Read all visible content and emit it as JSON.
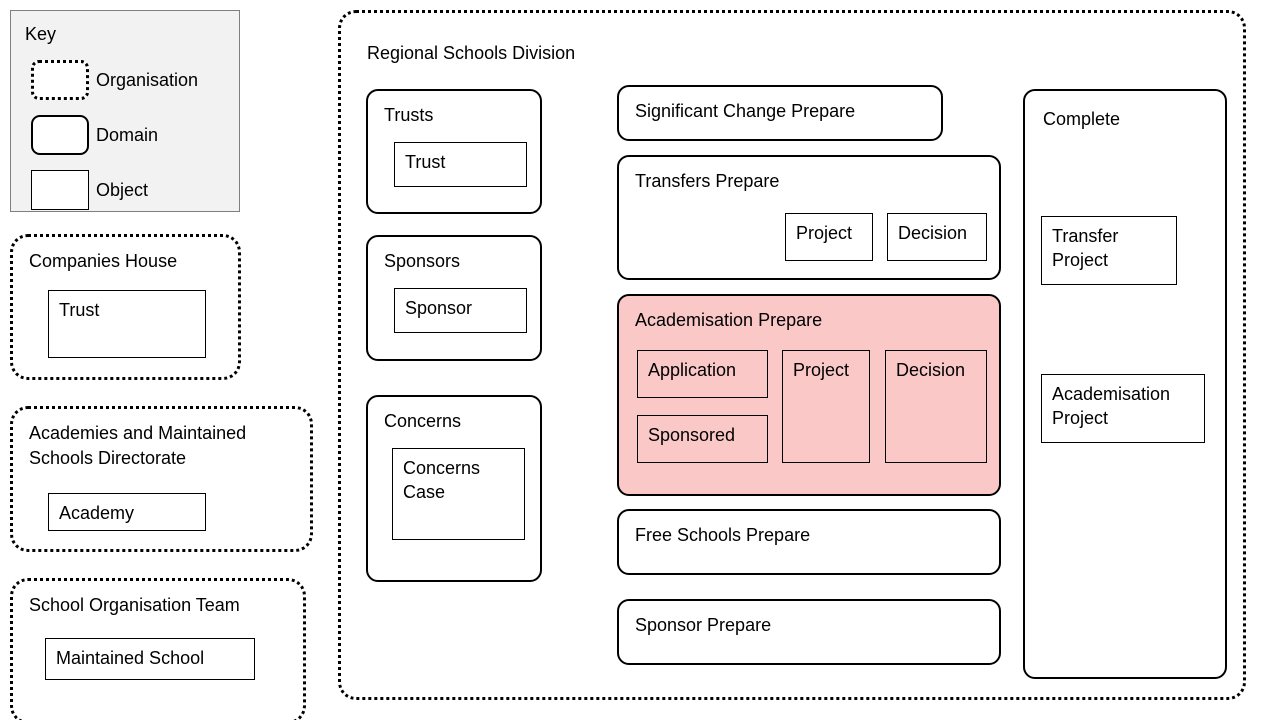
{
  "key": {
    "title": "Key",
    "rows": [
      {
        "shape": "organisation",
        "label": "Organisation"
      },
      {
        "shape": "domain",
        "label": "Domain"
      },
      {
        "shape": "object",
        "label": "Object"
      }
    ]
  },
  "external_organisations": [
    {
      "name": "Companies House",
      "objects": [
        "Trust"
      ]
    },
    {
      "name": "Academies and Maintained\nSchools Directorate",
      "objects": [
        "Academy"
      ]
    },
    {
      "name": "School Organisation Team",
      "objects": [
        "Maintained School"
      ]
    }
  ],
  "main_organisation": {
    "name": "Regional Schools Division",
    "entity_domains": [
      {
        "name": "Trusts",
        "objects": [
          "Trust"
        ]
      },
      {
        "name": "Sponsors",
        "objects": [
          "Sponsor"
        ]
      },
      {
        "name": "Concerns",
        "objects": [
          "Concerns\nCase"
        ]
      }
    ],
    "process_domains": [
      {
        "name": "Significant Change Prepare",
        "highlighted": false,
        "objects": []
      },
      {
        "name": "Transfers Prepare",
        "highlighted": false,
        "objects": [
          "Project",
          "Decision"
        ]
      },
      {
        "name": "Academisation Prepare",
        "highlighted": true,
        "objects": [
          "Application",
          "Sponsored",
          "Project",
          "Decision"
        ]
      },
      {
        "name": "Free Schools Prepare",
        "highlighted": false,
        "objects": []
      },
      {
        "name": "Sponsor Prepare",
        "highlighted": false,
        "objects": []
      }
    ],
    "complete_domain": {
      "name": "Complete",
      "objects": [
        "Transfer\nProject",
        "Academisation\nProject"
      ]
    }
  },
  "colors": {
    "highlight_fill": "#fbc8c8",
    "key_background": "#f2f2f2",
    "stroke": "#000000"
  }
}
